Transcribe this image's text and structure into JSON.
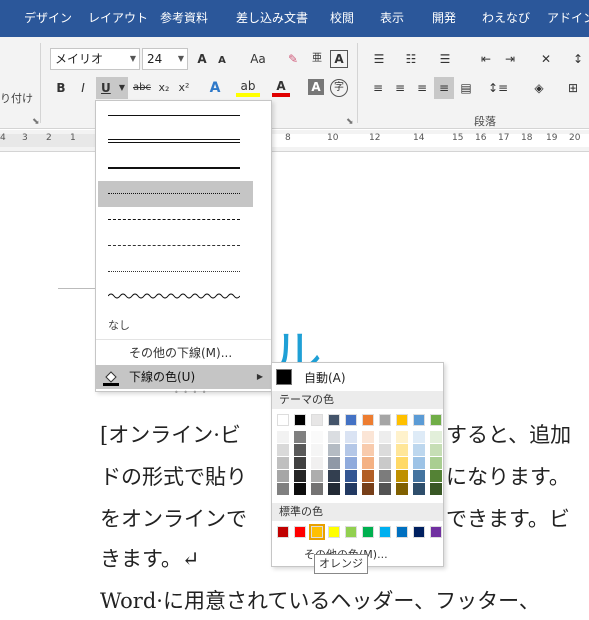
{
  "tabs": [
    "デザイン",
    "レイアウト",
    "参考資料",
    "差し込み文書",
    "校閲",
    "表示",
    "開発",
    "わえなび",
    "アドイン"
  ],
  "ribbon": {
    "paste_tail_label": "り付け",
    "font_name": "メイリオ",
    "font_size": "24",
    "grow_label": "A",
    "shrink_label": "A",
    "case_label": "Aa",
    "bold_label": "B",
    "italic_label": "I",
    "underline_label": "U",
    "strike_label": "abc",
    "sub_label": "x₂",
    "sup_label": "x²",
    "paragraph_group_label": "段落"
  },
  "ruler": {
    "left_ticks": [
      "4",
      "3",
      "2",
      "1"
    ],
    "right_ticks": [
      "8",
      "10",
      "12",
      "14",
      "15",
      "16",
      "17",
      "18",
      "19",
      "20"
    ]
  },
  "underline_menu": {
    "none_label": "なし",
    "more_label": "その他の下線(M)...",
    "color_label": "下線の色(U)"
  },
  "color_menu": {
    "auto_label": "自動(A)",
    "theme_header": "テーマの色",
    "standard_header": "標準の色",
    "more_label": "その他の色(M)...",
    "tooltip": "オレンジ",
    "theme_base": [
      "#ffffff",
      "#000000",
      "#e7e6e6",
      "#44546a",
      "#4472c4",
      "#ed7d31",
      "#a5a5a5",
      "#ffc000",
      "#5b9bd5",
      "#70ad47"
    ],
    "standard": [
      "#c00000",
      "#ff0000",
      "#ffc000",
      "#ffff00",
      "#92d050",
      "#00b050",
      "#00b0f0",
      "#0070c0",
      "#002060",
      "#7030a0"
    ]
  },
  "document": {
    "line1": "[オンライン·ビ",
    "line1b": "すると、追加",
    "line2": "ドの形式で貼り",
    "line2b": "になります。",
    "line3": "をオンラインで",
    "line3b": "できます。ビ",
    "line4": "きます。↵",
    "line5": "Word·に用意されているヘッダー、フッター、",
    "big_char": "ル"
  }
}
